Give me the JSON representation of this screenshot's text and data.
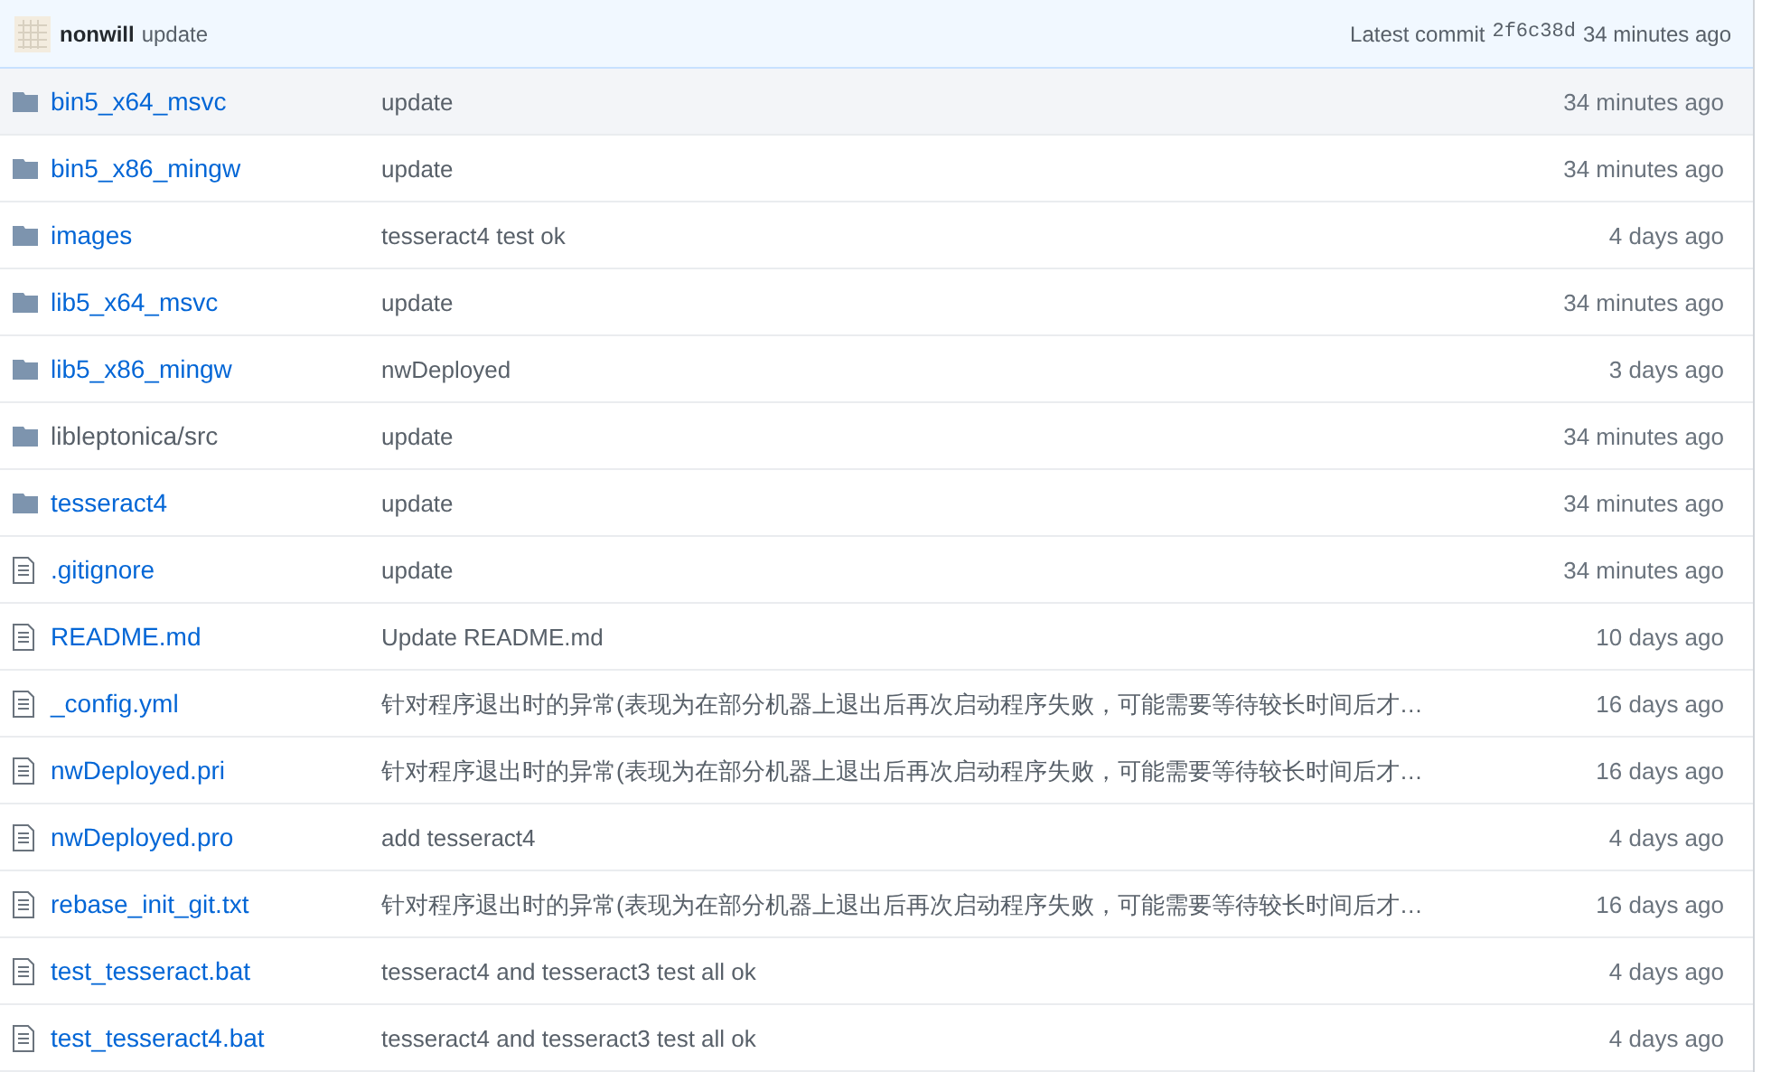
{
  "commit_bar": {
    "author": "nonwill",
    "message": "update",
    "latest_label": "Latest commit",
    "sha": "2f6c38d",
    "age": "34 minutes ago"
  },
  "files": [
    {
      "kind": "folder",
      "name": "bin5_x64_msvc",
      "message": "update",
      "age": "34 minutes ago",
      "highlighted": true,
      "muted": false
    },
    {
      "kind": "folder",
      "name": "bin5_x86_mingw",
      "message": "update",
      "age": "34 minutes ago",
      "highlighted": false,
      "muted": false
    },
    {
      "kind": "folder",
      "name": "images",
      "message": "tesseract4 test ok",
      "age": "4 days ago",
      "highlighted": false,
      "muted": false
    },
    {
      "kind": "folder",
      "name": "lib5_x64_msvc",
      "message": "update",
      "age": "34 minutes ago",
      "highlighted": false,
      "muted": false
    },
    {
      "kind": "folder",
      "name": "lib5_x86_mingw",
      "message": "nwDeployed",
      "age": "3 days ago",
      "highlighted": false,
      "muted": false
    },
    {
      "kind": "folder",
      "name": "libleptonica/src",
      "message": "update",
      "age": "34 minutes ago",
      "highlighted": false,
      "muted": true
    },
    {
      "kind": "folder",
      "name": "tesseract4",
      "message": "update",
      "age": "34 minutes ago",
      "highlighted": false,
      "muted": false
    },
    {
      "kind": "file",
      "name": ".gitignore",
      "message": "update",
      "age": "34 minutes ago",
      "highlighted": false,
      "muted": false
    },
    {
      "kind": "file",
      "name": "README.md",
      "message": "Update README.md",
      "age": "10 days ago",
      "highlighted": false,
      "muted": false
    },
    {
      "kind": "file",
      "name": "_config.yml",
      "message": "针对程序退出时的异常(表现为在部分机器上退出后再次启动程序失败，可能需要等待较长时间后才…",
      "age": "16 days ago",
      "highlighted": false,
      "muted": false
    },
    {
      "kind": "file",
      "name": "nwDeployed.pri",
      "message": "针对程序退出时的异常(表现为在部分机器上退出后再次启动程序失败，可能需要等待较长时间后才…",
      "age": "16 days ago",
      "highlighted": false,
      "muted": false
    },
    {
      "kind": "file",
      "name": "nwDeployed.pro",
      "message": "add tesseract4",
      "age": "4 days ago",
      "highlighted": false,
      "muted": false
    },
    {
      "kind": "file",
      "name": "rebase_init_git.txt",
      "message": "针对程序退出时的异常(表现为在部分机器上退出后再次启动程序失败，可能需要等待较长时间后才…",
      "age": "16 days ago",
      "highlighted": false,
      "muted": false
    },
    {
      "kind": "file",
      "name": "test_tesseract.bat",
      "message": "tesseract4 and tesseract3 test all ok",
      "age": "4 days ago",
      "highlighted": false,
      "muted": false
    },
    {
      "kind": "file",
      "name": "test_tesseract4.bat",
      "message": "tesseract4 and tesseract3 test all ok",
      "age": "4 days ago",
      "highlighted": false,
      "muted": false
    }
  ]
}
